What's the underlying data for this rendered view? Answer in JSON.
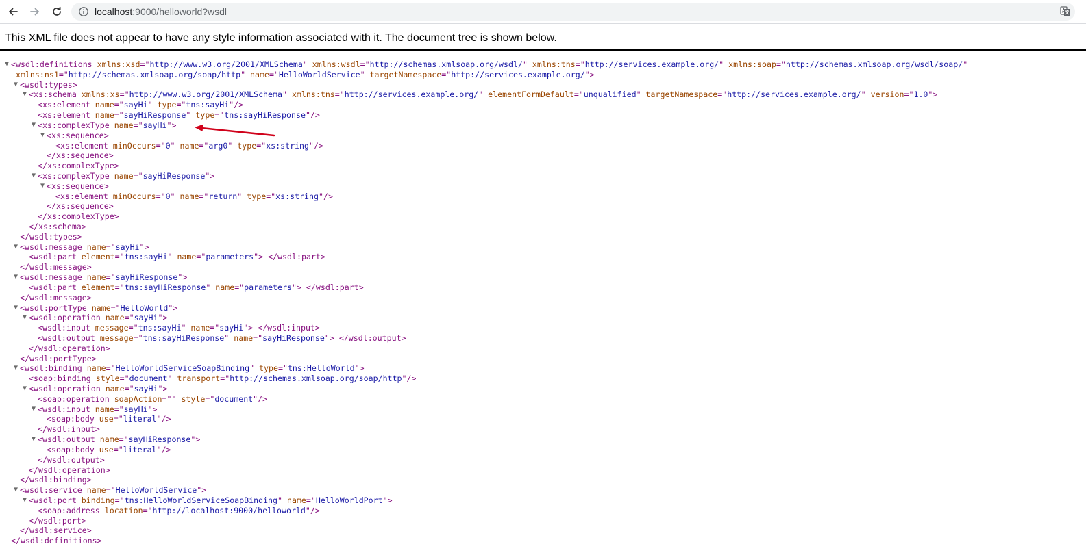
{
  "browser": {
    "url_host": "localhost",
    "url_rest": ":9000/helloworld?wsdl",
    "nav_icons": [
      "back-arrow-icon",
      "forward-arrow-icon",
      "reload-icon",
      "info-icon",
      "translate-icon"
    ]
  },
  "notice": "This XML file does not appear to have any style information associated with it. The document tree is shown below.",
  "tree": [
    {
      "d": 0,
      "c": true,
      "p": [
        [
          "t",
          "<wsdl:definitions"
        ],
        [
          "an",
          "xmlns:xsd"
        ],
        [
          "t",
          "=\""
        ],
        [
          "av",
          "http://www.w3.org/2001/XMLSchema"
        ],
        [
          "t",
          "\""
        ],
        [
          "an",
          "xmlns:wsdl"
        ],
        [
          "t",
          "=\""
        ],
        [
          "av",
          "http://schemas.xmlsoap.org/wsdl/"
        ],
        [
          "t",
          "\""
        ],
        [
          "an",
          "xmlns:tns"
        ],
        [
          "t",
          "=\""
        ],
        [
          "av",
          "http://services.example.org/"
        ],
        [
          "t",
          "\""
        ],
        [
          "an",
          "xmlns:soap"
        ],
        [
          "t",
          "=\""
        ],
        [
          "av",
          "http://schemas.xmlsoap.org/wsdl/soap/"
        ],
        [
          "t",
          "\""
        ]
      ]
    },
    {
      "d": 0,
      "c": false,
      "p": [
        [
          "an",
          "xmlns:ns1"
        ],
        [
          "t",
          "=\""
        ],
        [
          "av",
          "http://schemas.xmlsoap.org/soap/http"
        ],
        [
          "t",
          "\""
        ],
        [
          "an",
          "name"
        ],
        [
          "t",
          "=\""
        ],
        [
          "av",
          "HelloWorldService"
        ],
        [
          "t",
          "\""
        ],
        [
          "an",
          "targetNamespace"
        ],
        [
          "t",
          "=\""
        ],
        [
          "av",
          "http://services.example.org/"
        ],
        [
          "t",
          "\">"
        ]
      ]
    },
    {
      "d": 1,
      "c": true,
      "p": [
        [
          "t",
          "<wsdl:types>"
        ]
      ]
    },
    {
      "d": 2,
      "c": true,
      "p": [
        [
          "t",
          "<xs:schema"
        ],
        [
          "an",
          "xmlns:xs"
        ],
        [
          "t",
          "=\""
        ],
        [
          "av",
          "http://www.w3.org/2001/XMLSchema"
        ],
        [
          "t",
          "\""
        ],
        [
          "an",
          "xmlns:tns"
        ],
        [
          "t",
          "=\""
        ],
        [
          "av",
          "http://services.example.org/"
        ],
        [
          "t",
          "\""
        ],
        [
          "an",
          "elementFormDefault"
        ],
        [
          "t",
          "=\""
        ],
        [
          "av",
          "unqualified"
        ],
        [
          "t",
          "\""
        ],
        [
          "an",
          "targetNamespace"
        ],
        [
          "t",
          "=\""
        ],
        [
          "av",
          "http://services.example.org/"
        ],
        [
          "t",
          "\""
        ],
        [
          "an",
          "version"
        ],
        [
          "t",
          "=\""
        ],
        [
          "av",
          "1.0"
        ],
        [
          "t",
          "\">"
        ]
      ]
    },
    {
      "d": 3,
      "c": false,
      "p": [
        [
          "t",
          "<xs:element"
        ],
        [
          "an",
          "name"
        ],
        [
          "t",
          "=\""
        ],
        [
          "av",
          "sayHi"
        ],
        [
          "t",
          "\""
        ],
        [
          "an",
          "type"
        ],
        [
          "t",
          "=\""
        ],
        [
          "av",
          "tns:sayHi"
        ],
        [
          "t",
          "\"/>"
        ]
      ]
    },
    {
      "d": 3,
      "c": false,
      "p": [
        [
          "t",
          "<xs:element"
        ],
        [
          "an",
          "name"
        ],
        [
          "t",
          "=\""
        ],
        [
          "av",
          "sayHiResponse"
        ],
        [
          "t",
          "\""
        ],
        [
          "an",
          "type"
        ],
        [
          "t",
          "=\""
        ],
        [
          "av",
          "tns:sayHiResponse"
        ],
        [
          "t",
          "\"/>"
        ]
      ]
    },
    {
      "d": 3,
      "c": true,
      "p": [
        [
          "t",
          "<xs:complexType"
        ],
        [
          "an",
          "name"
        ],
        [
          "t",
          "=\""
        ],
        [
          "av",
          "sayHi"
        ],
        [
          "t",
          "\">"
        ]
      ]
    },
    {
      "d": 4,
      "c": true,
      "p": [
        [
          "t",
          "<xs:sequence>"
        ]
      ]
    },
    {
      "d": 5,
      "c": false,
      "p": [
        [
          "t",
          "<xs:element"
        ],
        [
          "an",
          "minOccurs"
        ],
        [
          "t",
          "=\""
        ],
        [
          "av",
          "0"
        ],
        [
          "t",
          "\""
        ],
        [
          "an",
          "name"
        ],
        [
          "t",
          "=\""
        ],
        [
          "av",
          "arg0"
        ],
        [
          "t",
          "\""
        ],
        [
          "an",
          "type"
        ],
        [
          "t",
          "=\""
        ],
        [
          "av",
          "xs:string"
        ],
        [
          "t",
          "\"/>"
        ]
      ]
    },
    {
      "d": 4,
      "c": false,
      "p": [
        [
          "t",
          "</xs:sequence>"
        ]
      ]
    },
    {
      "d": 3,
      "c": false,
      "p": [
        [
          "t",
          "</xs:complexType>"
        ]
      ]
    },
    {
      "d": 3,
      "c": true,
      "p": [
        [
          "t",
          "<xs:complexType"
        ],
        [
          "an",
          "name"
        ],
        [
          "t",
          "=\""
        ],
        [
          "av",
          "sayHiResponse"
        ],
        [
          "t",
          "\">"
        ]
      ]
    },
    {
      "d": 4,
      "c": true,
      "p": [
        [
          "t",
          "<xs:sequence>"
        ]
      ]
    },
    {
      "d": 5,
      "c": false,
      "p": [
        [
          "t",
          "<xs:element"
        ],
        [
          "an",
          "minOccurs"
        ],
        [
          "t",
          "=\""
        ],
        [
          "av",
          "0"
        ],
        [
          "t",
          "\""
        ],
        [
          "an",
          "name"
        ],
        [
          "t",
          "=\""
        ],
        [
          "av",
          "return"
        ],
        [
          "t",
          "\""
        ],
        [
          "an",
          "type"
        ],
        [
          "t",
          "=\""
        ],
        [
          "av",
          "xs:string"
        ],
        [
          "t",
          "\"/>"
        ]
      ]
    },
    {
      "d": 4,
      "c": false,
      "p": [
        [
          "t",
          "</xs:sequence>"
        ]
      ]
    },
    {
      "d": 3,
      "c": false,
      "p": [
        [
          "t",
          "</xs:complexType>"
        ]
      ]
    },
    {
      "d": 2,
      "c": false,
      "p": [
        [
          "t",
          "</xs:schema>"
        ]
      ]
    },
    {
      "d": 1,
      "c": false,
      "p": [
        [
          "t",
          "</wsdl:types>"
        ]
      ]
    },
    {
      "d": 1,
      "c": true,
      "p": [
        [
          "t",
          "<wsdl:message"
        ],
        [
          "an",
          "name"
        ],
        [
          "t",
          "=\""
        ],
        [
          "av",
          "sayHi"
        ],
        [
          "t",
          "\">"
        ]
      ]
    },
    {
      "d": 2,
      "c": false,
      "p": [
        [
          "t",
          "<wsdl:part"
        ],
        [
          "an",
          "element"
        ],
        [
          "t",
          "=\""
        ],
        [
          "av",
          "tns:sayHi"
        ],
        [
          "t",
          "\""
        ],
        [
          "an",
          "name"
        ],
        [
          "t",
          "=\""
        ],
        [
          "av",
          "parameters"
        ],
        [
          "t",
          "\"> </wsdl:part>"
        ]
      ]
    },
    {
      "d": 1,
      "c": false,
      "p": [
        [
          "t",
          "</wsdl:message>"
        ]
      ]
    },
    {
      "d": 1,
      "c": true,
      "p": [
        [
          "t",
          "<wsdl:message"
        ],
        [
          "an",
          "name"
        ],
        [
          "t",
          "=\""
        ],
        [
          "av",
          "sayHiResponse"
        ],
        [
          "t",
          "\">"
        ]
      ]
    },
    {
      "d": 2,
      "c": false,
      "p": [
        [
          "t",
          "<wsdl:part"
        ],
        [
          "an",
          "element"
        ],
        [
          "t",
          "=\""
        ],
        [
          "av",
          "tns:sayHiResponse"
        ],
        [
          "t",
          "\""
        ],
        [
          "an",
          "name"
        ],
        [
          "t",
          "=\""
        ],
        [
          "av",
          "parameters"
        ],
        [
          "t",
          "\"> </wsdl:part>"
        ]
      ]
    },
    {
      "d": 1,
      "c": false,
      "p": [
        [
          "t",
          "</wsdl:message>"
        ]
      ]
    },
    {
      "d": 1,
      "c": true,
      "p": [
        [
          "t",
          "<wsdl:portType"
        ],
        [
          "an",
          "name"
        ],
        [
          "t",
          "=\""
        ],
        [
          "av",
          "HelloWorld"
        ],
        [
          "t",
          "\">"
        ]
      ]
    },
    {
      "d": 2,
      "c": true,
      "p": [
        [
          "t",
          "<wsdl:operation"
        ],
        [
          "an",
          "name"
        ],
        [
          "t",
          "=\""
        ],
        [
          "av",
          "sayHi"
        ],
        [
          "t",
          "\">"
        ]
      ]
    },
    {
      "d": 3,
      "c": false,
      "p": [
        [
          "t",
          "<wsdl:input"
        ],
        [
          "an",
          "message"
        ],
        [
          "t",
          "=\""
        ],
        [
          "av",
          "tns:sayHi"
        ],
        [
          "t",
          "\""
        ],
        [
          "an",
          "name"
        ],
        [
          "t",
          "=\""
        ],
        [
          "av",
          "sayHi"
        ],
        [
          "t",
          "\"> </wsdl:input>"
        ]
      ]
    },
    {
      "d": 3,
      "c": false,
      "p": [
        [
          "t",
          "<wsdl:output"
        ],
        [
          "an",
          "message"
        ],
        [
          "t",
          "=\""
        ],
        [
          "av",
          "tns:sayHiResponse"
        ],
        [
          "t",
          "\""
        ],
        [
          "an",
          "name"
        ],
        [
          "t",
          "=\""
        ],
        [
          "av",
          "sayHiResponse"
        ],
        [
          "t",
          "\"> </wsdl:output>"
        ]
      ]
    },
    {
      "d": 2,
      "c": false,
      "p": [
        [
          "t",
          "</wsdl:operation>"
        ]
      ]
    },
    {
      "d": 1,
      "c": false,
      "p": [
        [
          "t",
          "</wsdl:portType>"
        ]
      ]
    },
    {
      "d": 1,
      "c": true,
      "p": [
        [
          "t",
          "<wsdl:binding"
        ],
        [
          "an",
          "name"
        ],
        [
          "t",
          "=\""
        ],
        [
          "av",
          "HelloWorldServiceSoapBinding"
        ],
        [
          "t",
          "\""
        ],
        [
          "an",
          "type"
        ],
        [
          "t",
          "=\""
        ],
        [
          "av",
          "tns:HelloWorld"
        ],
        [
          "t",
          "\">"
        ]
      ]
    },
    {
      "d": 2,
      "c": false,
      "p": [
        [
          "t",
          "<soap:binding"
        ],
        [
          "an",
          "style"
        ],
        [
          "t",
          "=\""
        ],
        [
          "av",
          "document"
        ],
        [
          "t",
          "\""
        ],
        [
          "an",
          "transport"
        ],
        [
          "t",
          "=\""
        ],
        [
          "av",
          "http://schemas.xmlsoap.org/soap/http"
        ],
        [
          "t",
          "\"/>"
        ]
      ]
    },
    {
      "d": 2,
      "c": true,
      "p": [
        [
          "t",
          "<wsdl:operation"
        ],
        [
          "an",
          "name"
        ],
        [
          "t",
          "=\""
        ],
        [
          "av",
          "sayHi"
        ],
        [
          "t",
          "\">"
        ]
      ]
    },
    {
      "d": 3,
      "c": false,
      "p": [
        [
          "t",
          "<soap:operation"
        ],
        [
          "an",
          "soapAction"
        ],
        [
          "t",
          "=\""
        ],
        [
          "av",
          ""
        ],
        [
          "t",
          "\""
        ],
        [
          "an",
          "style"
        ],
        [
          "t",
          "=\""
        ],
        [
          "av",
          "document"
        ],
        [
          "t",
          "\"/>"
        ]
      ]
    },
    {
      "d": 3,
      "c": true,
      "p": [
        [
          "t",
          "<wsdl:input"
        ],
        [
          "an",
          "name"
        ],
        [
          "t",
          "=\""
        ],
        [
          "av",
          "sayHi"
        ],
        [
          "t",
          "\">"
        ]
      ]
    },
    {
      "d": 4,
      "c": false,
      "p": [
        [
          "t",
          "<soap:body"
        ],
        [
          "an",
          "use"
        ],
        [
          "t",
          "=\""
        ],
        [
          "av",
          "literal"
        ],
        [
          "t",
          "\"/>"
        ]
      ]
    },
    {
      "d": 3,
      "c": false,
      "p": [
        [
          "t",
          "</wsdl:input>"
        ]
      ]
    },
    {
      "d": 3,
      "c": true,
      "p": [
        [
          "t",
          "<wsdl:output"
        ],
        [
          "an",
          "name"
        ],
        [
          "t",
          "=\""
        ],
        [
          "av",
          "sayHiResponse"
        ],
        [
          "t",
          "\">"
        ]
      ]
    },
    {
      "d": 4,
      "c": false,
      "p": [
        [
          "t",
          "<soap:body"
        ],
        [
          "an",
          "use"
        ],
        [
          "t",
          "=\""
        ],
        [
          "av",
          "literal"
        ],
        [
          "t",
          "\"/>"
        ]
      ]
    },
    {
      "d": 3,
      "c": false,
      "p": [
        [
          "t",
          "</wsdl:output>"
        ]
      ]
    },
    {
      "d": 2,
      "c": false,
      "p": [
        [
          "t",
          "</wsdl:operation>"
        ]
      ]
    },
    {
      "d": 1,
      "c": false,
      "p": [
        [
          "t",
          "</wsdl:binding>"
        ]
      ]
    },
    {
      "d": 1,
      "c": true,
      "p": [
        [
          "t",
          "<wsdl:service"
        ],
        [
          "an",
          "name"
        ],
        [
          "t",
          "=\""
        ],
        [
          "av",
          "HelloWorldService"
        ],
        [
          "t",
          "\">"
        ]
      ]
    },
    {
      "d": 2,
      "c": true,
      "p": [
        [
          "t",
          "<wsdl:port"
        ],
        [
          "an",
          "binding"
        ],
        [
          "t",
          "=\""
        ],
        [
          "av",
          "tns:HelloWorldServiceSoapBinding"
        ],
        [
          "t",
          "\""
        ],
        [
          "an",
          "name"
        ],
        [
          "t",
          "=\""
        ],
        [
          "av",
          "HelloWorldPort"
        ],
        [
          "t",
          "\">"
        ]
      ]
    },
    {
      "d": 3,
      "c": false,
      "p": [
        [
          "t",
          "<soap:address"
        ],
        [
          "an",
          "location"
        ],
        [
          "t",
          "=\""
        ],
        [
          "av",
          "http://localhost:9000/helloworld"
        ],
        [
          "t",
          "\"/>"
        ]
      ]
    },
    {
      "d": 2,
      "c": false,
      "p": [
        [
          "t",
          "</wsdl:port>"
        ]
      ]
    },
    {
      "d": 1,
      "c": false,
      "p": [
        [
          "t",
          "</wsdl:service>"
        ]
      ]
    },
    {
      "d": 0,
      "c": false,
      "p": [
        [
          "t",
          "</wsdl:definitions>"
        ]
      ]
    }
  ],
  "colors": {
    "tag": "#881280",
    "attr_name": "#994500",
    "attr_value": "#1a1aa6",
    "annotation_arrow": "#d0021b"
  }
}
